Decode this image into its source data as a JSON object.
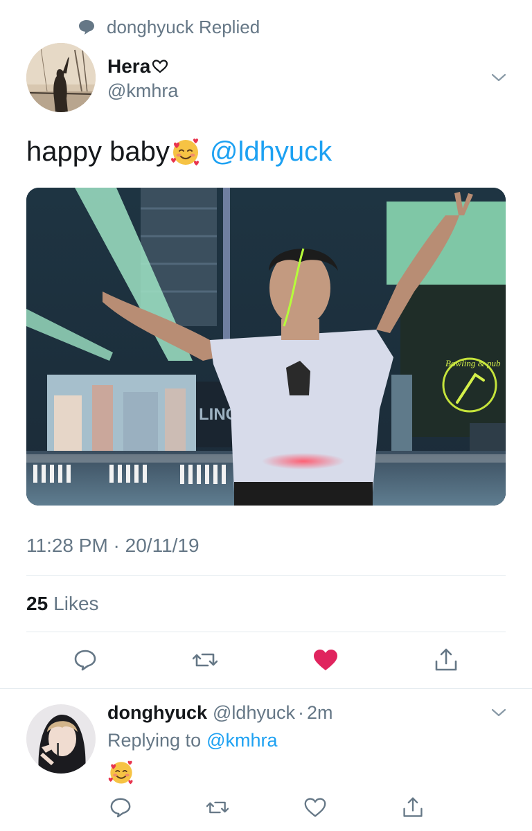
{
  "context": {
    "replied_text": "donghyuck Replied"
  },
  "tweet": {
    "author_name": "Hera",
    "author_handle": "@kmhra",
    "text": "happy baby",
    "mention": "@ldhyuck",
    "timestamp": "11:28 PM · 20/11/19",
    "likes_count": "25",
    "likes_label": "Likes",
    "media_overlay_text": "LING",
    "media_sign_text": "Bowling & pub"
  },
  "reply": {
    "author_name": "donghyuck",
    "author_handle": "@ldhyuck",
    "separator": "·",
    "time": "2m",
    "replying_to_label": "Replying to",
    "replying_to_handle": "@kmhra"
  },
  "icons": {
    "reply": "reply-icon",
    "retweet": "retweet-icon",
    "like_filled": "heart-filled-icon",
    "like_outline": "heart-outline-icon",
    "share": "share-icon",
    "chevron": "chevron-down-icon",
    "emoji": "smiling-face-with-hearts"
  },
  "colors": {
    "link": "#1da1f2",
    "secondary_text": "#657786",
    "like_active": "#e0245e",
    "divider": "#e1e8ed"
  }
}
